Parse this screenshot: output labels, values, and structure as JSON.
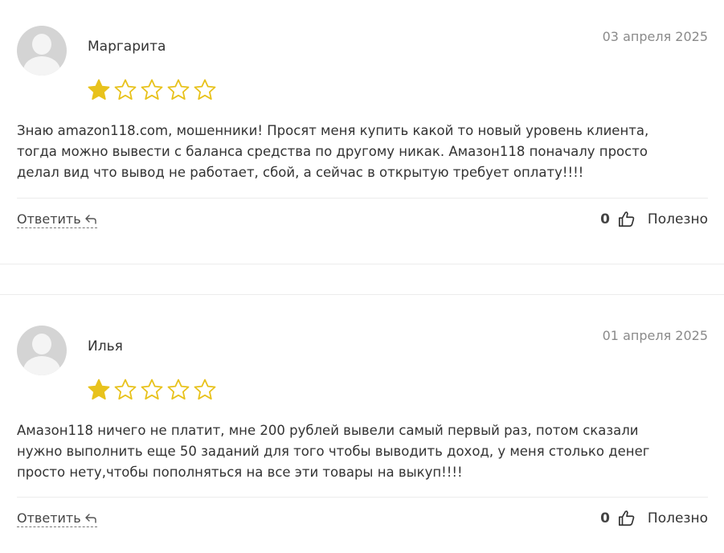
{
  "reviews": [
    {
      "author": "Маргарита",
      "date": "03 апреля 2025",
      "rating": 1,
      "max_rating": 5,
      "text_lines": [
        "Знаю amazon118.com, мошенники! Просят меня купить какой то новый уровень клиента,",
        "тогда можно вывести с баланса средства по другому никак. Амазон118 поначалу просто",
        "делал вид что вывод не работает, сбой, а сейчас в открытую требует оплату!!!!"
      ],
      "reply_label": "Ответить",
      "helpful_count": "0",
      "helpful_label": "Полезно"
    },
    {
      "author": "Илья",
      "date": "01 апреля 2025",
      "rating": 1,
      "max_rating": 5,
      "text_lines": [
        "Амазон118 ничего не платит, мне 200 рублей вывели самый первый раз, потом сказали",
        "нужно выполнить еще 50 заданий для того чтобы выводить доход, у меня столько денег",
        "просто нету,чтобы пополняться на все эти товары на выкуп!!!!"
      ],
      "reply_label": "Ответить",
      "helpful_count": "0",
      "helpful_label": "Полезно"
    }
  ],
  "icons": {
    "avatar": "user-avatar-placeholder",
    "star_filled": "star-filled-icon",
    "star_empty": "star-outline-icon",
    "reply": "reply-arrow-icon",
    "thumb": "thumbs-up-icon"
  },
  "colors": {
    "star": "#e8c21c",
    "text": "#333333",
    "date": "#8a8a8a"
  }
}
